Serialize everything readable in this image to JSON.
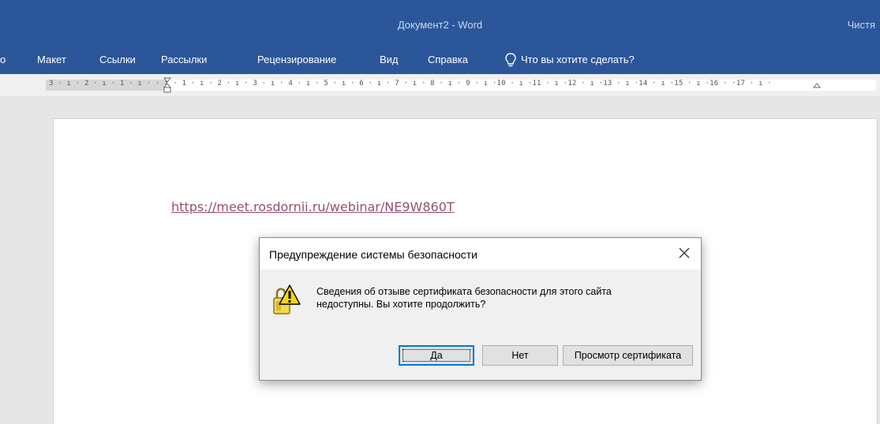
{
  "window": {
    "title": "Документ2  -  Word",
    "right_text": "Чистя"
  },
  "ribbon": {
    "edge_tab": "о",
    "tabs": [
      "Макет",
      "Ссылки",
      "Рассылки",
      "Рецензирование",
      "Вид",
      "Справка"
    ],
    "tell_me": "Что вы хотите сделать?"
  },
  "ruler": {
    "text": "3 · ı · 2 · ı · 1 · ı ·   · ı · 1 · ı · 2 · ı · 3 · ı · 4 · ı · 5 · ı · 6 · ı · 7 · ı · 8 · ı · 9 · ı ·10 · ı ·11 · ı ·12 · ı ·13 · ı ·14 · ı ·15 · ı ·16 ·   ·17 · ı ·"
  },
  "document": {
    "hyperlink": "https://meet.rosdornii.ru/webinar/NE9W860T"
  },
  "dialog": {
    "title": "Предупреждение системы безопасности",
    "message_line1": "Сведения об отзыве сертификата безопасности для этого сайта",
    "message_line2": "недоступны. Вы хотите продолжить?",
    "yes_label": "Да",
    "no_label": "Нет",
    "cert_label": "Просмотр сертификата"
  }
}
